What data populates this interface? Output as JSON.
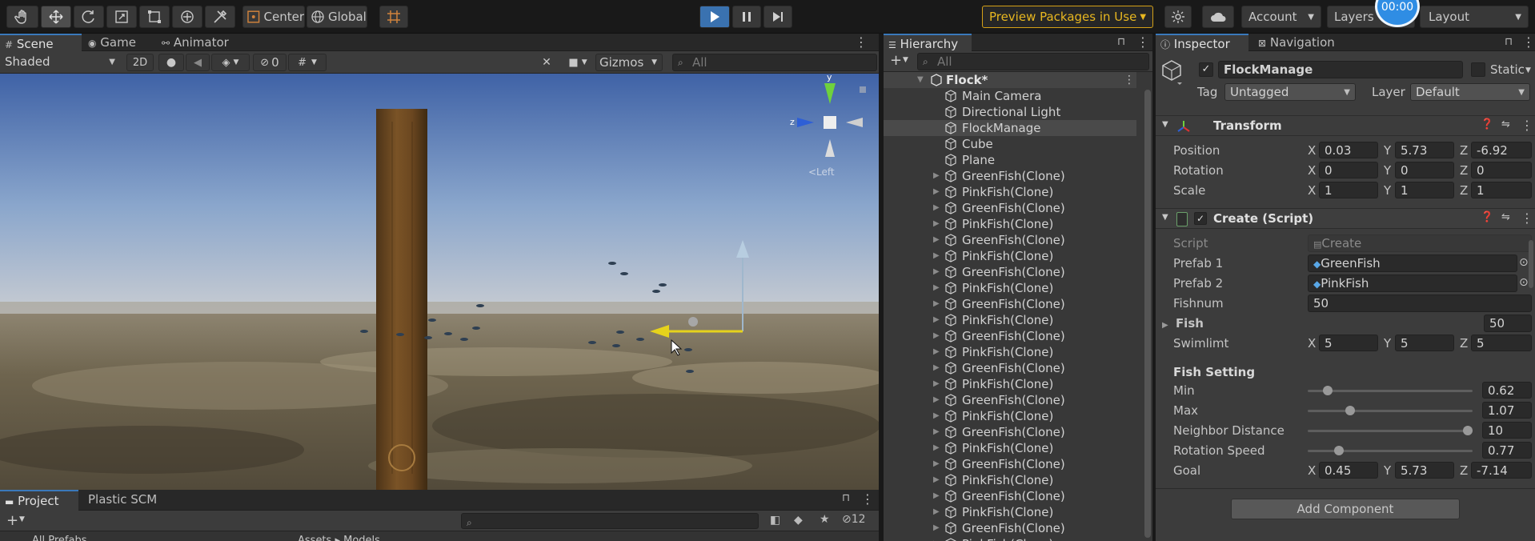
{
  "toolbar": {
    "pivot": "Center",
    "space": "Global",
    "preview_packages": "Preview Packages in Use",
    "account": "Account",
    "layers": "Layers",
    "layout": "Layout",
    "timer": "00:00"
  },
  "scene": {
    "tabs": [
      "Scene",
      "Game",
      "Animator"
    ],
    "shading": "Shaded",
    "mode_2d": "2D",
    "hidden_count": "0",
    "gizmos": "Gizmos",
    "search_placeholder": "All",
    "gizmo_label": "<Left"
  },
  "hierarchy": {
    "title": "Hierarchy",
    "search_placeholder": "All",
    "root": "Flock*",
    "items": [
      "Main Camera",
      "Directional Light",
      "FlockManage",
      "Cube",
      "Plane"
    ],
    "clones": [
      "GreenFish(Clone)",
      "PinkFish(Clone)",
      "GreenFish(Clone)",
      "PinkFish(Clone)",
      "GreenFish(Clone)",
      "PinkFish(Clone)",
      "GreenFish(Clone)",
      "PinkFish(Clone)",
      "GreenFish(Clone)",
      "PinkFish(Clone)",
      "GreenFish(Clone)",
      "PinkFish(Clone)",
      "GreenFish(Clone)",
      "PinkFish(Clone)",
      "GreenFish(Clone)",
      "PinkFish(Clone)",
      "GreenFish(Clone)",
      "PinkFish(Clone)",
      "GreenFish(Clone)",
      "PinkFish(Clone)",
      "GreenFish(Clone)",
      "PinkFish(Clone)",
      "GreenFish(Clone)",
      "PinkFish(Clone)"
    ]
  },
  "inspector": {
    "tabs": [
      "Inspector",
      "Navigation"
    ],
    "object_name": "FlockManage",
    "static": "Static",
    "tag_label": "Tag",
    "tag_value": "Untagged",
    "layer_label": "Layer",
    "layer_value": "Default",
    "transform": {
      "title": "Transform",
      "position_label": "Position",
      "rotation_label": "Rotation",
      "scale_label": "Scale",
      "position": [
        "0.03",
        "5.73",
        "-6.92"
      ],
      "rotation": [
        "0",
        "0",
        "0"
      ],
      "scale": [
        "1",
        "1",
        "1"
      ]
    },
    "script": {
      "title": "Create (Script)",
      "script_label": "Script",
      "script_value": "Create",
      "prefab1_label": "Prefab 1",
      "prefab1_value": "GreenFish",
      "prefab2_label": "Prefab 2",
      "prefab2_value": "PinkFish",
      "fishnum_label": "Fishnum",
      "fishnum_value": "50",
      "fish_label": "Fish",
      "fish_value": "50",
      "swimlimt_label": "Swimlimt",
      "swimlimt": [
        "5",
        "5",
        "5"
      ],
      "fish_setting": "Fish Setting",
      "sliders": [
        {
          "label": "Min",
          "value": "0.62",
          "fraction": 0.1
        },
        {
          "label": "Max",
          "value": "1.07",
          "fraction": 0.24
        },
        {
          "label": "Neighbor Distance",
          "value": "10",
          "fraction": 1.0
        },
        {
          "label": "Rotation Speed",
          "value": "0.77",
          "fraction": 0.17
        }
      ],
      "goal_label": "Goal",
      "goal": [
        "0.45",
        "5.73",
        "-7.14"
      ]
    },
    "add_component": "Add Component"
  },
  "project": {
    "tabs": [
      "Project",
      "Plastic SCM"
    ],
    "hidden_count": "12",
    "favorites": "All Prefabs",
    "breadcrumb": [
      "Assets",
      "Models"
    ]
  },
  "axes": {
    "x": "X",
    "y": "Y",
    "z": "Z"
  }
}
